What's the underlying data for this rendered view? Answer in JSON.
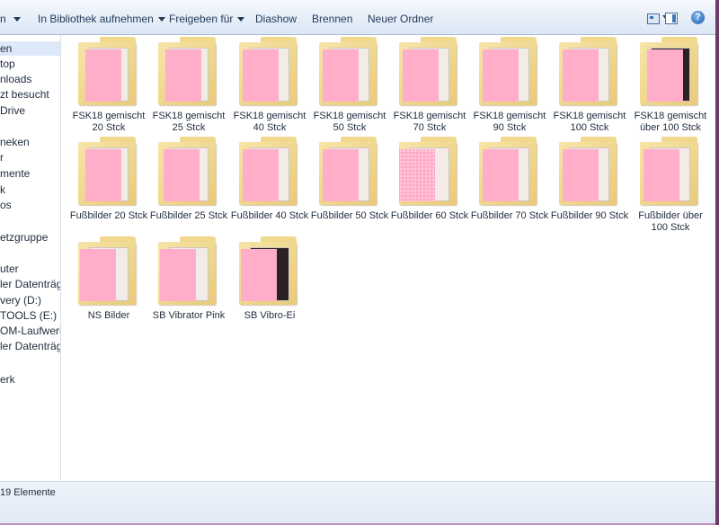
{
  "toolbar": {
    "organize_label": "n",
    "library_label": "In Bibliothek aufnehmen",
    "share_label": "Freigeben für",
    "slideshow_label": "Diashow",
    "burn_label": "Brennen",
    "new_folder_label": "Neuer Ordner",
    "views_icon": "views-grid-icon",
    "preview_pane_icon": "preview-pane-icon",
    "help_label": "?"
  },
  "nav": {
    "items": [
      {
        "label": "en",
        "selected": true
      },
      {
        "label": "top"
      },
      {
        "label": "nloads"
      },
      {
        "label": "zt besucht"
      },
      {
        "label": "Drive"
      },
      {
        "label": "neken"
      },
      {
        "label": "r"
      },
      {
        "label": "mente"
      },
      {
        "label": "k"
      },
      {
        "label": "os"
      },
      {
        "label": "etzgruppe"
      },
      {
        "label": "uter"
      },
      {
        "label": "ler Datenträger"
      },
      {
        "label": "very (D:)"
      },
      {
        "label": "TOOLS (E:)"
      },
      {
        "label": "OM-Laufwerk ("
      },
      {
        "label": "ler Datenträger"
      },
      {
        "label": "erk"
      }
    ]
  },
  "folders": [
    {
      "line1": "FSK18 gemischt",
      "line2": "20 Stck"
    },
    {
      "line1": "FSK18 gemischt",
      "line2": "25 Stck"
    },
    {
      "line1": "FSK18 gemischt",
      "line2": "40 Stck"
    },
    {
      "line1": "FSK18 gemischt",
      "line2": "50 Stck"
    },
    {
      "line1": "FSK18 gemischt",
      "line2": "70 Stck"
    },
    {
      "line1": "FSK18 gemischt",
      "line2": "90 Stck"
    },
    {
      "line1": "FSK18 gemischt",
      "line2": "100 Stck"
    },
    {
      "line1": "FSK18 gemischt",
      "line2": "über 100 Stck"
    },
    {
      "line1": "Fußbilder 20 Stck",
      "line2": ""
    },
    {
      "line1": "Fußbilder 25 Stck",
      "line2": ""
    },
    {
      "line1": "Fußbilder 40 Stck",
      "line2": ""
    },
    {
      "line1": "Fußbilder 50 Stck",
      "line2": ""
    },
    {
      "line1": "Fußbilder 60 Stck",
      "line2": ""
    },
    {
      "line1": "Fußbilder 70 Stck",
      "line2": ""
    },
    {
      "line1": "Fußbilder 90 Stck",
      "line2": ""
    },
    {
      "line1": "Fußbilder über",
      "line2": "100 Stck"
    },
    {
      "line1": "NS Bilder",
      "line2": ""
    },
    {
      "line1": "SB Vibrator Pink",
      "line2": ""
    },
    {
      "line1": "SB Vibro-Ei",
      "line2": ""
    }
  ],
  "status": {
    "text": "19 Elemente"
  },
  "colors": {
    "redaction": "#ffadc9",
    "folder": "#eccf80",
    "toolbar": "#dce6f4"
  }
}
